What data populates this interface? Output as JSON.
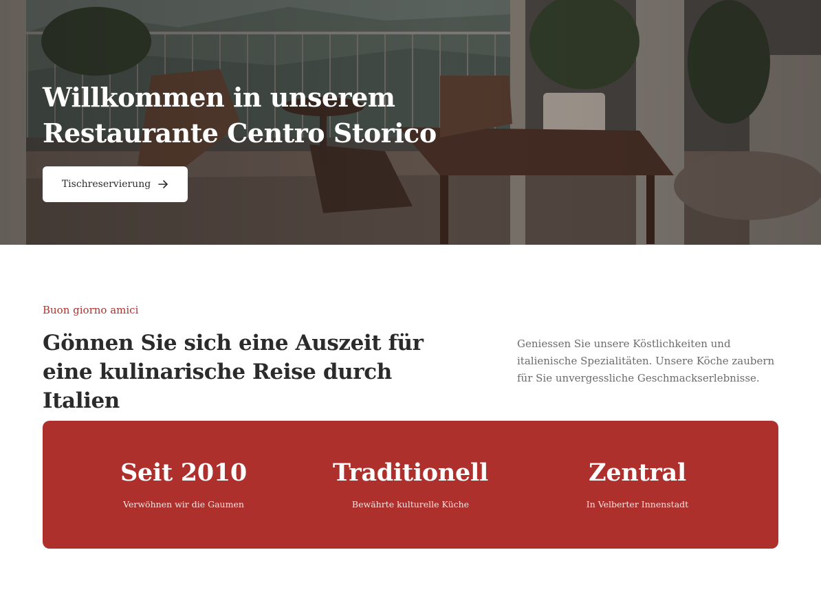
{
  "hero": {
    "title_line1": "Willkommen in unserem",
    "title_line2": "Restaurante Centro Storico",
    "reserve_label": "Tischreservierung",
    "reserve_icon": "arrow-right-icon"
  },
  "intro": {
    "eyebrow": "Buon giorno amici",
    "headline_line1": "Gönnen Sie sich eine Auszeit für",
    "headline_line2": "eine kulinarische Reise durch Italien",
    "text_line1": "Geniessen Sie unsere Köstlichkeiten und",
    "text_line2": "italienische Spezialitäten. Unsere Köche zaubern",
    "text_line3": "für Sie unvergessliche Geschmackserlebnisse."
  },
  "stats": [
    {
      "title": "Seit 2010",
      "subtitle": "Verwöhnen wir die Gaumen"
    },
    {
      "title": "Traditionell",
      "subtitle": "Bewährte kulturelle Küche"
    },
    {
      "title": "Zentral",
      "subtitle": "In Velberter Innenstadt"
    }
  ],
  "colors": {
    "accent": "#ad302d",
    "eyebrow": "#b0322e",
    "text": "#2b2b2b",
    "muted": "#6b6b6b"
  }
}
